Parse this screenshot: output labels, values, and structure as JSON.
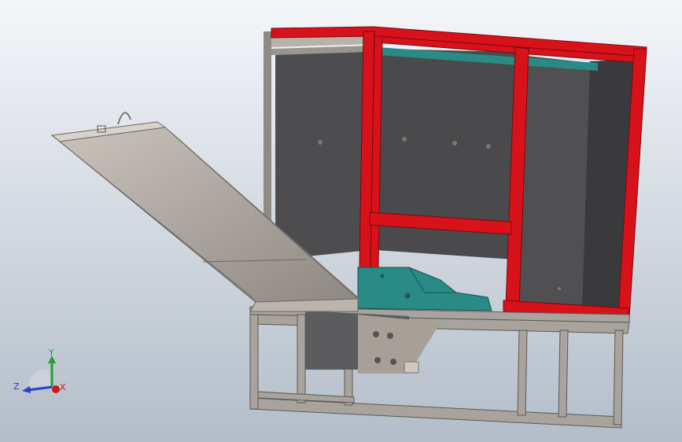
{
  "viewport": {
    "background_top": "#f4f6f9",
    "background_bottom": "#b3bdc9"
  },
  "colors": {
    "frame_red": "#d8121a",
    "frame_red_dark": "#8c0a0f",
    "panel_grey": "#4b4b4d",
    "panel_grey_dark": "#3a3a3c",
    "sheet_metal": "#8a847e",
    "sheet_metal_light": "#bdb7b0",
    "teal_part": "#2a8a86",
    "base_frame": "#a8a39c"
  },
  "triad": {
    "x_label": "X",
    "y_label": "Y",
    "z_label": "Z",
    "x_color": "#d0151b",
    "y_color": "#22a22a",
    "z_color": "#2a3fd0"
  }
}
